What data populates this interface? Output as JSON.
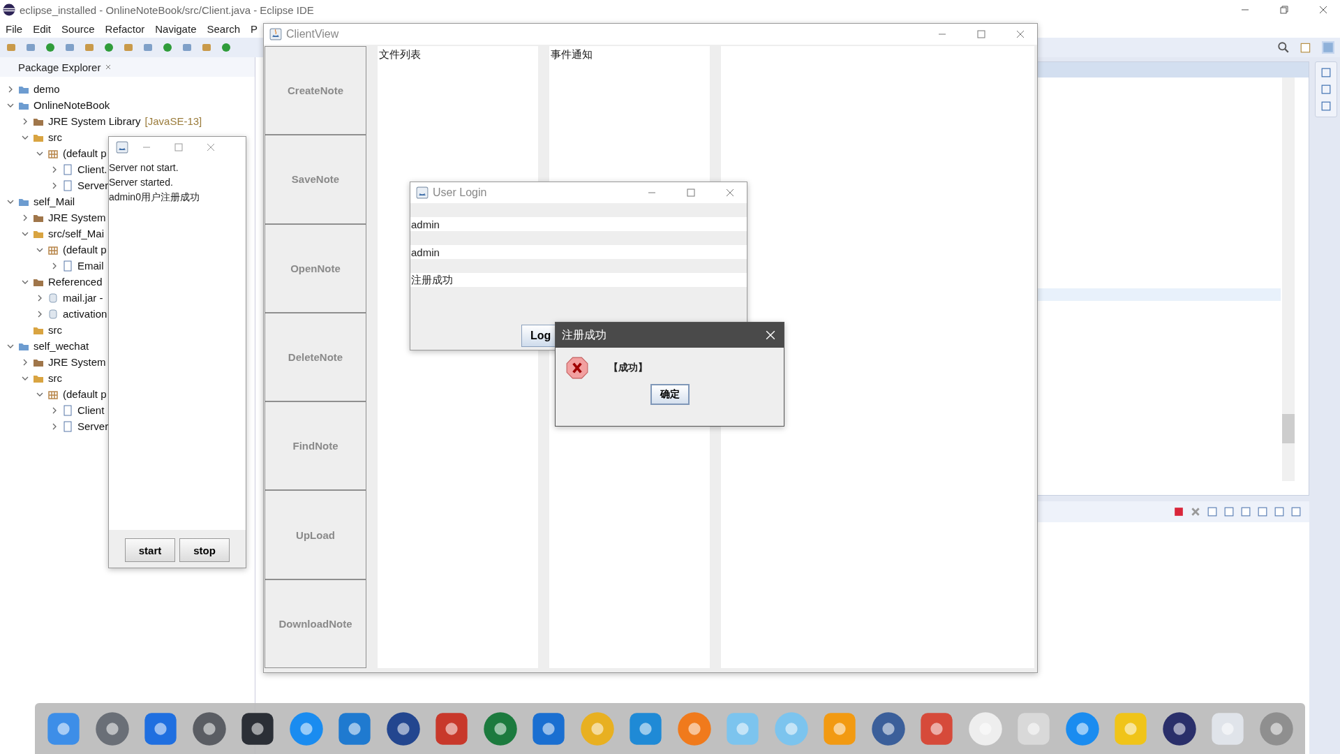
{
  "eclipse": {
    "title": "eclipse_installed - OnlineNoteBook/src/Client.java - Eclipse IDE",
    "menu": [
      "File",
      "Edit",
      "Source",
      "Refactor",
      "Navigate",
      "Search",
      "P"
    ],
    "explorer": {
      "title": "Package Explorer",
      "tree": [
        {
          "label": "demo",
          "kind": "project",
          "expanded": false
        },
        {
          "label": "OnlineNoteBook",
          "kind": "project",
          "expanded": true,
          "children": [
            {
              "label": "JRE System Library",
              "decoration": "[JavaSE-13]",
              "kind": "library",
              "expanded": false
            },
            {
              "label": "src",
              "kind": "source",
              "expanded": true,
              "children": [
                {
                  "label": "(default p",
                  "kind": "package",
                  "expanded": true,
                  "children": [
                    {
                      "label": "Client.",
                      "kind": "java",
                      "expanded": false
                    },
                    {
                      "label": "Server",
                      "kind": "java",
                      "expanded": false
                    }
                  ]
                }
              ]
            }
          ]
        },
        {
          "label": "self_Mail",
          "kind": "project",
          "expanded": true,
          "children": [
            {
              "label": "JRE System",
              "kind": "library",
              "expanded": false
            },
            {
              "label": "src/self_Mai",
              "kind": "source",
              "expanded": true,
              "children": [
                {
                  "label": "(default p",
                  "kind": "package",
                  "expanded": true,
                  "children": [
                    {
                      "label": "Email",
                      "kind": "java",
                      "expanded": false
                    }
                  ]
                }
              ]
            },
            {
              "label": "Referenced",
              "kind": "library",
              "expanded": true,
              "children": [
                {
                  "label": "mail.jar -",
                  "kind": "jar",
                  "expanded": false
                },
                {
                  "label": "activation",
                  "kind": "jar",
                  "expanded": false
                }
              ]
            },
            {
              "label": "src",
              "kind": "folder"
            }
          ]
        },
        {
          "label": "self_wechat",
          "kind": "project",
          "expanded": true,
          "children": [
            {
              "label": "JRE System",
              "kind": "library",
              "expanded": false
            },
            {
              "label": "src",
              "kind": "source",
              "expanded": true,
              "children": [
                {
                  "label": "(default p",
                  "kind": "package",
                  "expanded": true,
                  "children": [
                    {
                      "label": "Client",
                      "kind": "java",
                      "expanded": false
                    },
                    {
                      "label": "Server",
                      "kind": "java",
                      "expanded": false
                    }
                  ]
                }
              ]
            }
          ]
        }
      ]
    }
  },
  "server_window": {
    "log": [
      "Server not start.",
      "Server started.",
      "admin0用户注册成功"
    ],
    "buttons": [
      "start",
      "stop"
    ]
  },
  "client_view": {
    "title": "ClientView",
    "buttons": [
      "CreateNote",
      "SaveNote",
      "OpenNote",
      "DeleteNote",
      "FindNote",
      "UpLoad",
      "DownloadNote"
    ],
    "file_list_label": "文件列表",
    "event_label": "事件通知"
  },
  "login": {
    "title": "User Login",
    "fields": [
      {
        "value": "admin"
      },
      {
        "value": "admin"
      },
      {
        "value": "注册成功"
      }
    ],
    "button": "Log"
  },
  "dialog": {
    "title": "注册成功",
    "message": "【成功】",
    "button": "确定"
  }
}
